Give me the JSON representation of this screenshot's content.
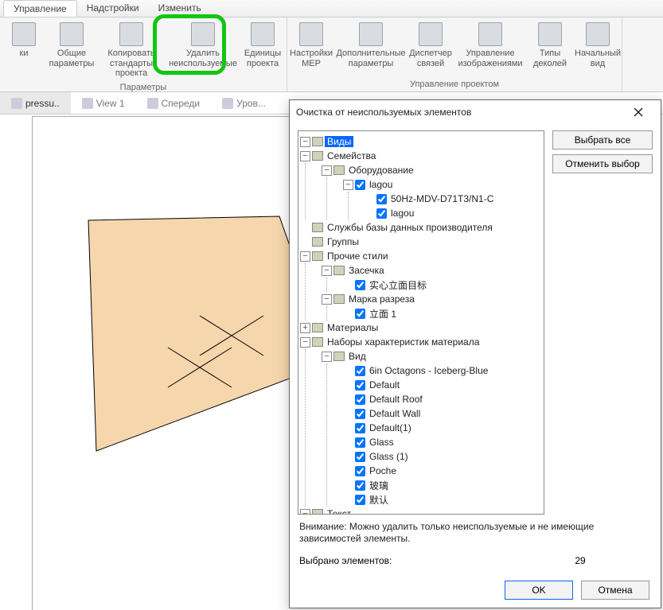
{
  "ribbon": {
    "tabs": [
      "Управление",
      "Надстройки",
      "Изменить"
    ],
    "active_tab": 0,
    "groups": [
      {
        "title": "Параметры",
        "buttons": [
          {
            "l1": "ки",
            "l2": ""
          },
          {
            "l1": "Общие",
            "l2": "параметры"
          },
          {
            "l1": "Копировать",
            "l2": "стандарты проекта",
            "wide": true
          },
          {
            "l1": "Удалить",
            "l2": "неиспользуемые",
            "wide": true
          },
          {
            "l1": "Единицы",
            "l2": "проекта"
          }
        ]
      },
      {
        "title": "Управление проектом",
        "buttons": [
          {
            "l1": "Настройки",
            "l2": "MEP"
          },
          {
            "l1": "Дополнительные",
            "l2": "параметры",
            "wide": true
          },
          {
            "l1": "Диспетчер",
            "l2": "связей"
          },
          {
            "l1": "Управление",
            "l2": "изображениями",
            "wide": true
          },
          {
            "l1": "Типы",
            "l2": "деколей"
          },
          {
            "l1": "Начальный",
            "l2": "вид"
          }
        ]
      }
    ]
  },
  "view_tabs": [
    {
      "label": "pressu..",
      "active": true
    },
    {
      "label": "View 1",
      "active": false
    },
    {
      "label": "Спереди",
      "active": false
    },
    {
      "label": "Уров...",
      "active": false
    }
  ],
  "dialog": {
    "title": "Очистка от неиспользуемых элементов",
    "btn_select_all": "Выбрать все",
    "btn_deselect_all": "Отменить выбор",
    "note": "Внимание: Можно удалить только неиспользуемые и не имеющие зависимостей элементы.",
    "count_label": "Выбрано элементов:",
    "count_value": "29",
    "ok": "OK",
    "cancel": "Отмена",
    "tree": [
      {
        "label": "Виды",
        "exp": "-",
        "selected": true
      },
      {
        "label": "Семейства",
        "exp": "-",
        "children": [
          {
            "label": "Оборудование",
            "exp": "-",
            "children": [
              {
                "label": "lagou",
                "exp": "-",
                "cb": true,
                "children": [
                  {
                    "label": "50Hz-MDV-D71T3/N1-C",
                    "cb": true
                  },
                  {
                    "label": "lagou",
                    "cb": true
                  }
                ]
              }
            ]
          }
        ]
      },
      {
        "label": "Службы базы данных производителя"
      },
      {
        "label": "Группы"
      },
      {
        "label": "Прочие стили",
        "exp": "-",
        "children": [
          {
            "label": "Засечка",
            "exp": "-",
            "children": [
              {
                "label": "实心立面目标",
                "cb": true
              }
            ]
          },
          {
            "label": "Марка разреза",
            "exp": "-",
            "children": [
              {
                "label": "立面 1",
                "cb": true
              }
            ]
          }
        ]
      },
      {
        "label": "Материалы",
        "exp": "+"
      },
      {
        "label": "Наборы характеристик материала",
        "exp": "-",
        "children": [
          {
            "label": "Вид",
            "exp": "-",
            "children": [
              {
                "label": "6in Octagons - Iceberg-Blue",
                "cb": true
              },
              {
                "label": "Default",
                "cb": true
              },
              {
                "label": "Default Roof",
                "cb": true
              },
              {
                "label": "Default Wall",
                "cb": true
              },
              {
                "label": "Default(1)",
                "cb": true
              },
              {
                "label": "Glass",
                "cb": true
              },
              {
                "label": "Glass (1)",
                "cb": true
              },
              {
                "label": "Poche",
                "cb": true
              },
              {
                "label": "玻璃",
                "cb": true
              },
              {
                "label": "默认",
                "cb": true
              }
            ]
          }
        ]
      },
      {
        "label": "Текст",
        "exp": "-"
      }
    ]
  }
}
